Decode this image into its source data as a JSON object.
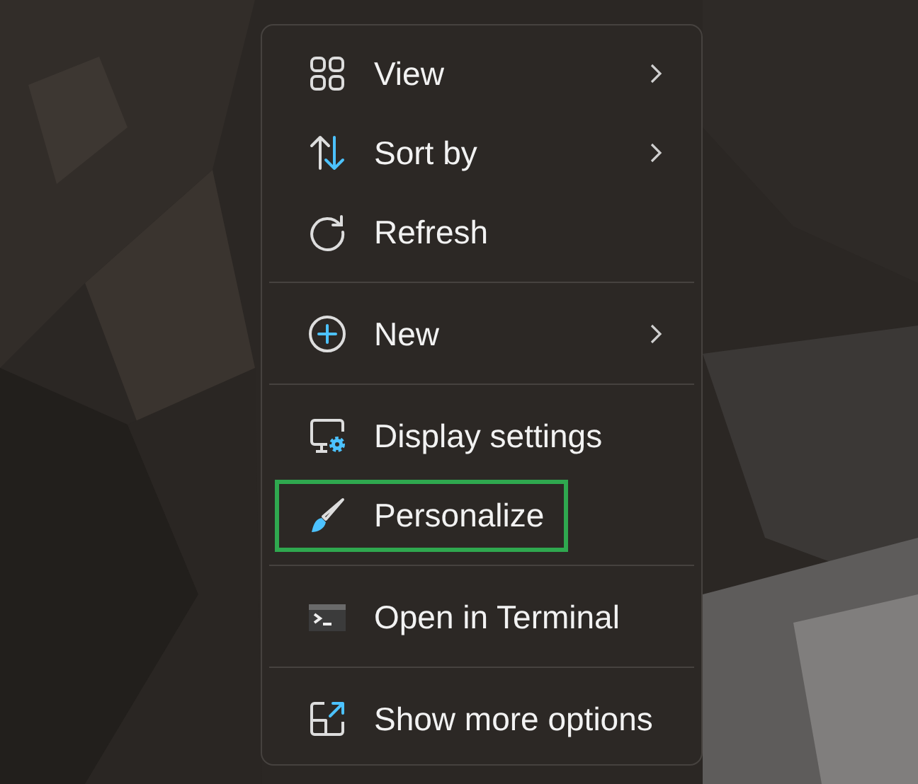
{
  "context_menu": {
    "groups": [
      {
        "items": [
          {
            "kind": "grid",
            "label": "View",
            "submenu": true,
            "highlighted": false
          },
          {
            "kind": "sort",
            "label": "Sort by",
            "submenu": true,
            "highlighted": false
          },
          {
            "kind": "refresh",
            "label": "Refresh",
            "submenu": false,
            "highlighted": false
          }
        ]
      },
      {
        "items": [
          {
            "kind": "new",
            "label": "New",
            "submenu": true,
            "highlighted": false
          }
        ]
      },
      {
        "items": [
          {
            "kind": "display",
            "label": "Display settings",
            "submenu": false,
            "highlighted": false
          },
          {
            "kind": "brush",
            "label": "Personalize",
            "submenu": false,
            "highlighted": true
          }
        ]
      },
      {
        "items": [
          {
            "kind": "terminal",
            "label": "Open in Terminal",
            "submenu": false,
            "highlighted": false
          }
        ]
      },
      {
        "items": [
          {
            "kind": "more",
            "label": "Show more options",
            "submenu": false,
            "highlighted": false
          }
        ]
      }
    ]
  }
}
